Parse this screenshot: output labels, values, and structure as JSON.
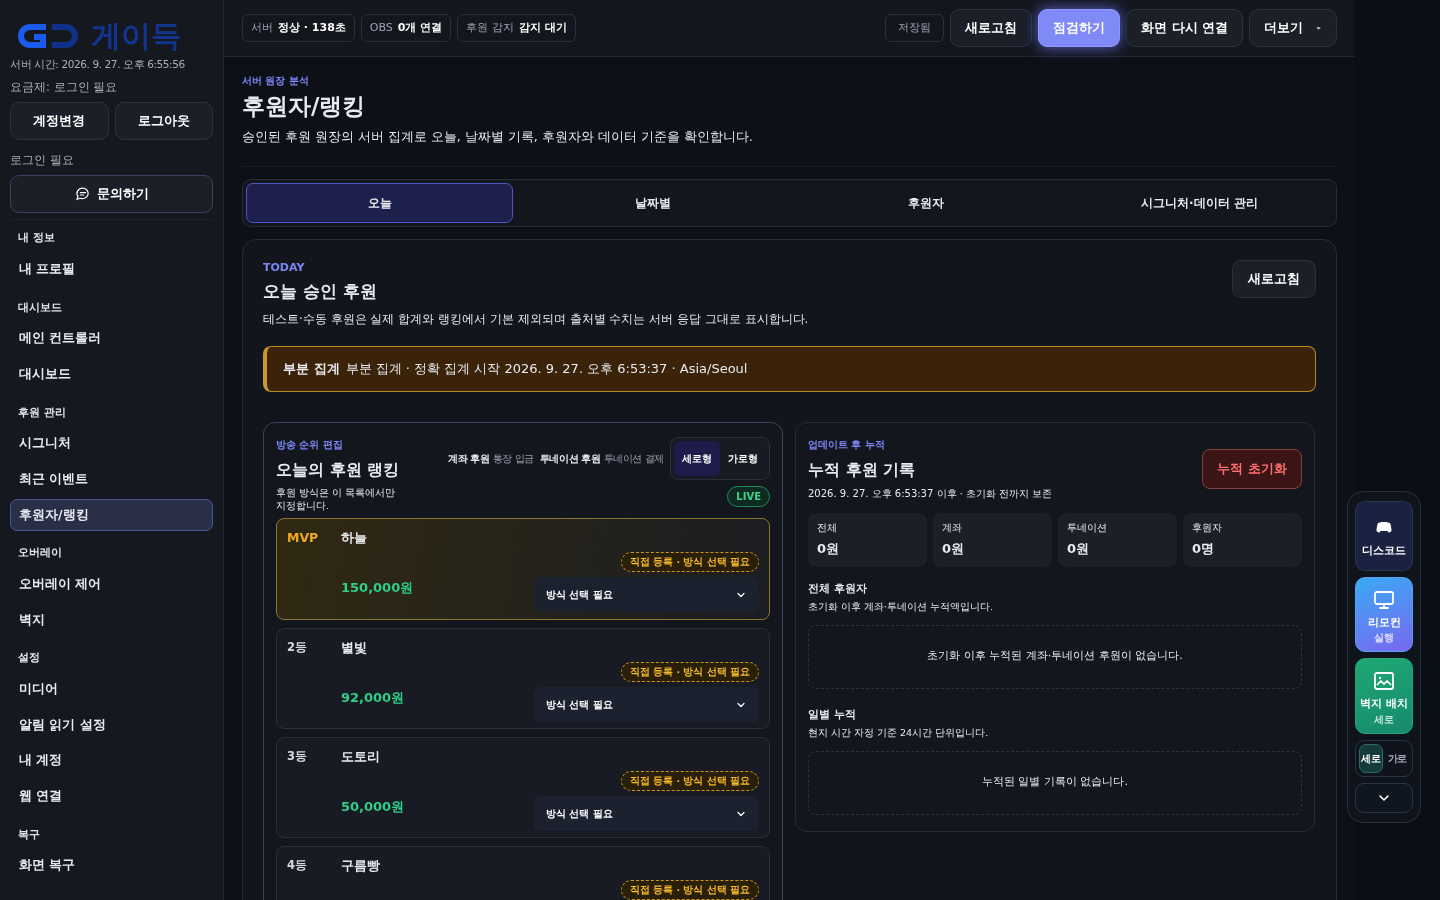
{
  "sidebar": {
    "logo_text": "게이득",
    "server_time": "서버 시간: 2026. 9. 27. 오후 6:55:56",
    "plan": "요금제: 로그인 필요",
    "account_buttons": [
      "계정변경",
      "로그아웃"
    ],
    "login_note": "로그인 필요",
    "inquiry_button": "문의하기",
    "sections": [
      {
        "title": "내 정보",
        "items": [
          {
            "label": "내 프로필",
            "selected": false
          }
        ]
      },
      {
        "title": "대시보드",
        "items": [
          {
            "label": "메인 컨트롤러",
            "selected": false
          },
          {
            "label": "대시보드",
            "selected": false
          }
        ]
      },
      {
        "title": "후원 관리",
        "items": [
          {
            "label": "시그니처",
            "selected": false
          },
          {
            "label": "최근 이벤트",
            "selected": false
          },
          {
            "label": "후원자/랭킹",
            "selected": true
          }
        ]
      },
      {
        "title": "오버레이",
        "items": [
          {
            "label": "오버레이 제어",
            "selected": false
          },
          {
            "label": "벽지",
            "selected": false
          }
        ]
      },
      {
        "title": "설정",
        "items": [
          {
            "label": "미디어",
            "selected": false
          },
          {
            "label": "알림 읽기 설정",
            "selected": false
          },
          {
            "label": "내 계정",
            "selected": false
          },
          {
            "label": "웹 연결",
            "selected": false
          }
        ]
      },
      {
        "title": "복구",
        "items": [
          {
            "label": "화면 복구",
            "selected": false
          }
        ]
      }
    ]
  },
  "topbar": {
    "status_chips": [
      {
        "label": "서버",
        "value": "정상 · 138초"
      },
      {
        "label": "OBS",
        "value": "0개 연결"
      },
      {
        "label": "후원 감지",
        "value": "감지 대기"
      }
    ],
    "saved": "저장됨",
    "buttons": [
      {
        "label": "새로고침",
        "kind": "default"
      },
      {
        "label": "점검하기",
        "kind": "primary"
      },
      {
        "label": "화면 다시 연결",
        "kind": "default"
      },
      {
        "label": "더보기",
        "kind": "dropdown"
      }
    ]
  },
  "header": {
    "eyebrow": "서버 원장 분석",
    "title": "후원자/랭킹",
    "description": "승인된 후원 원장의 서버 집계로 오늘, 날짜별 기록, 후원자와 데이터 기준을 확인합니다."
  },
  "tabs": [
    {
      "label": "오늘",
      "selected": true
    },
    {
      "label": "날짜별",
      "selected": false
    },
    {
      "label": "후원자",
      "selected": false
    },
    {
      "label": "시그니처·데이터 관리",
      "selected": false
    }
  ],
  "today": {
    "eyebrow": "TODAY",
    "title": "오늘 승인 후원",
    "description": "테스트·수동 후원은 실제 합계와 랭킹에서 기본 제외되며 출처별 수치는 서버 응답 그대로 표시합니다.",
    "refresh_button": "새로고침",
    "notice": {
      "label": "부분 집계",
      "text": "부분 집계 · 정확 집계 시작 2026. 9. 27. 오후 6:53:37 · Asia/Seoul"
    }
  },
  "ranking": {
    "eyebrow": "방송 순위 편집",
    "title": "오늘의 후원 랭킹",
    "description": "후원 방식은 이 목록에서만 지정합니다.",
    "legend": [
      {
        "label": "계좌 후원",
        "detail": "통장 입금"
      },
      {
        "label": "투네이션 후원",
        "detail": "투네이션 결제"
      }
    ],
    "layout_toggle": [
      {
        "label": "세로형",
        "selected": true
      },
      {
        "label": "가로형",
        "selected": false
      }
    ],
    "live": "LIVE",
    "rows": [
      {
        "kind": "mvp",
        "rank": "MVP",
        "name": "하늘",
        "amount": "150,000원",
        "tag": "직접 등록 · 방식 선택 필요",
        "select": "방식 선택 필요"
      },
      {
        "kind": "normal",
        "rank": "2등",
        "name": "별빛",
        "amount": "92,000원",
        "tag": "직접 등록 · 방식 선택 필요",
        "select": "방식 선택 필요"
      },
      {
        "kind": "normal",
        "rank": "3등",
        "name": "도토리",
        "amount": "50,000원",
        "tag": "직접 등록 · 방식 선택 필요",
        "select": "방식 선택 필요"
      },
      {
        "kind": "normal",
        "rank": "4등",
        "name": "구름빵",
        "tag": "직접 등록 · 방식 선택 필요"
      }
    ]
  },
  "cumulative": {
    "eyebrow": "업데이트 후 누적",
    "title": "누적 후원 기록",
    "subtitle": "2026. 9. 27. 오후 6:53:37 이후 · 초기화 전까지 보존",
    "reset_button": "누적 초기화",
    "stats": [
      {
        "label": "전체",
        "value": "0원"
      },
      {
        "label": "계좌",
        "value": "0원"
      },
      {
        "label": "투네이션",
        "value": "0원"
      },
      {
        "label": "후원자",
        "value": "0명"
      }
    ],
    "sections": [
      {
        "title": "전체 후원자",
        "description": "초기화 이후 계좌·투네이션 누적액입니다.",
        "empty": "초기화 이후 누적된 계좌·투네이션 후원이 없습니다."
      },
      {
        "title": "일별 누적",
        "description": "현지 시간 자정 기준 24시간 단위입니다.",
        "empty": "누적된 일별 기록이 없습니다."
      }
    ]
  },
  "dock": {
    "items": [
      {
        "kind": "discord",
        "label": "디스코드"
      },
      {
        "kind": "remote",
        "label": "리모컨",
        "sublabel": "실행"
      },
      {
        "kind": "wallpaper",
        "label": "벽지 배치",
        "sublabel": "세로"
      }
    ],
    "orientation": [
      {
        "label": "세로",
        "selected": true
      },
      {
        "label": "가로",
        "selected": false
      }
    ]
  }
}
